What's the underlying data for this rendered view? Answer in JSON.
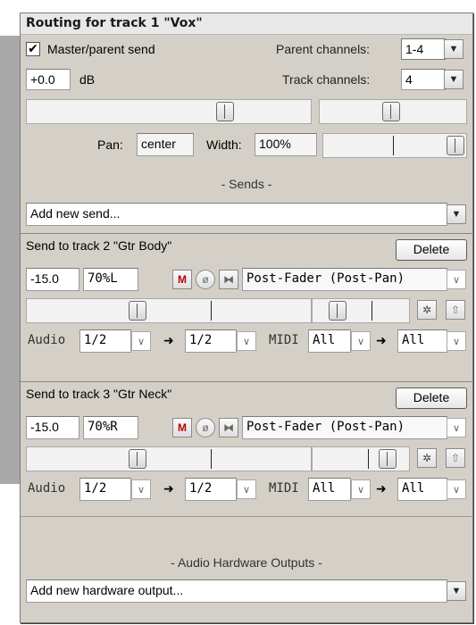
{
  "title": "Routing for track 1 \"Vox\"",
  "master": {
    "checkbox_label": "Master/parent send",
    "checked": true,
    "parent_channels_label": "Parent channels:",
    "parent_channels_value": "1-4",
    "volume_value": "+0.0",
    "volume_unit": "dB",
    "track_channels_label": "Track channels:",
    "track_channels_value": "4",
    "pan_label": "Pan:",
    "pan_value": "center",
    "width_label": "Width:",
    "width_value": "100%"
  },
  "sends_header": "- Sends -",
  "add_send_placeholder": "Add new send...",
  "sends": [
    {
      "title": "Send to track 2 \"Gtr Body\"",
      "delete_label": "Delete",
      "volume": "-15.0",
      "pan": "70%L",
      "mute_label": "M",
      "mode": "Post-Fader (Post-Pan)",
      "audio_label": "Audio",
      "audio_src": "1/2",
      "audio_dst": "1/2",
      "midi_label": "MIDI",
      "midi_src": "All",
      "midi_dst": "All"
    },
    {
      "title": "Send to track 3 \"Gtr Neck\"",
      "delete_label": "Delete",
      "volume": "-15.0",
      "pan": "70%R",
      "mute_label": "M",
      "mode": "Post-Fader (Post-Pan)",
      "audio_label": "Audio",
      "audio_src": "1/2",
      "audio_dst": "1/2",
      "midi_label": "MIDI",
      "midi_src": "All",
      "midi_dst": "All"
    }
  ],
  "hw_header": "- Audio Hardware Outputs -",
  "add_hw_placeholder": "Add new hardware output...",
  "icons": {
    "dropdown": "chevron-down-icon",
    "arrow": "right-arrow-icon",
    "phase": "phase-invert-icon",
    "mono": "mono-stereo-icon",
    "envelope": "envelope-icon",
    "fx": "fx-icon"
  }
}
